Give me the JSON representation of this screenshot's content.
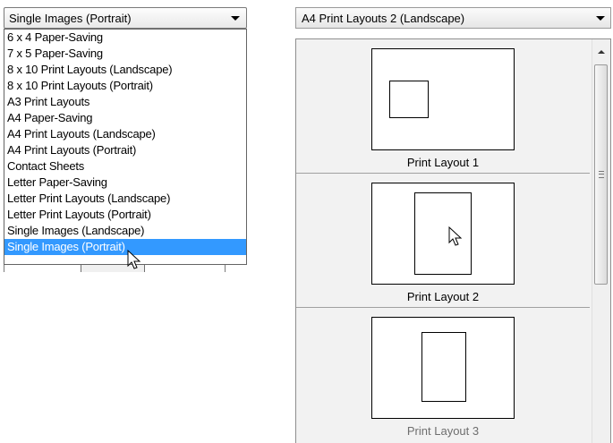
{
  "left_dropdown": {
    "selected": "Single Images (Portrait)",
    "options": [
      "6 x 4 Paper-Saving",
      "7 x 5 Paper-Saving",
      "8 x 10 Print Layouts (Landscape)",
      "8 x 10 Print Layouts (Portrait)",
      "A3 Print Layouts",
      "A4 Paper-Saving",
      "A4 Print Layouts (Landscape)",
      "A4 Print Layouts (Portrait)",
      "Contact Sheets",
      "Letter Paper-Saving",
      "Letter Print Layouts (Landscape)",
      "Letter Print Layouts (Portrait)",
      "Single Images (Landscape)",
      "Single Images (Portrait)"
    ],
    "highlighted_index": 13
  },
  "right_dropdown": {
    "selected": "A4 Print Layouts 2 (Landscape)"
  },
  "layouts": [
    {
      "label": "Print Layout 1"
    },
    {
      "label": "Print Layout 2"
    },
    {
      "label": "Print Layout 3"
    }
  ],
  "icons": {
    "dropdown_arrow": "chevron-down-icon",
    "cursor": "mouse-pointer-icon",
    "scroll_up": "scroll-up-arrow-icon"
  },
  "colors": {
    "selection": "#3399ff",
    "gallery_bg": "#f2f2f2"
  }
}
